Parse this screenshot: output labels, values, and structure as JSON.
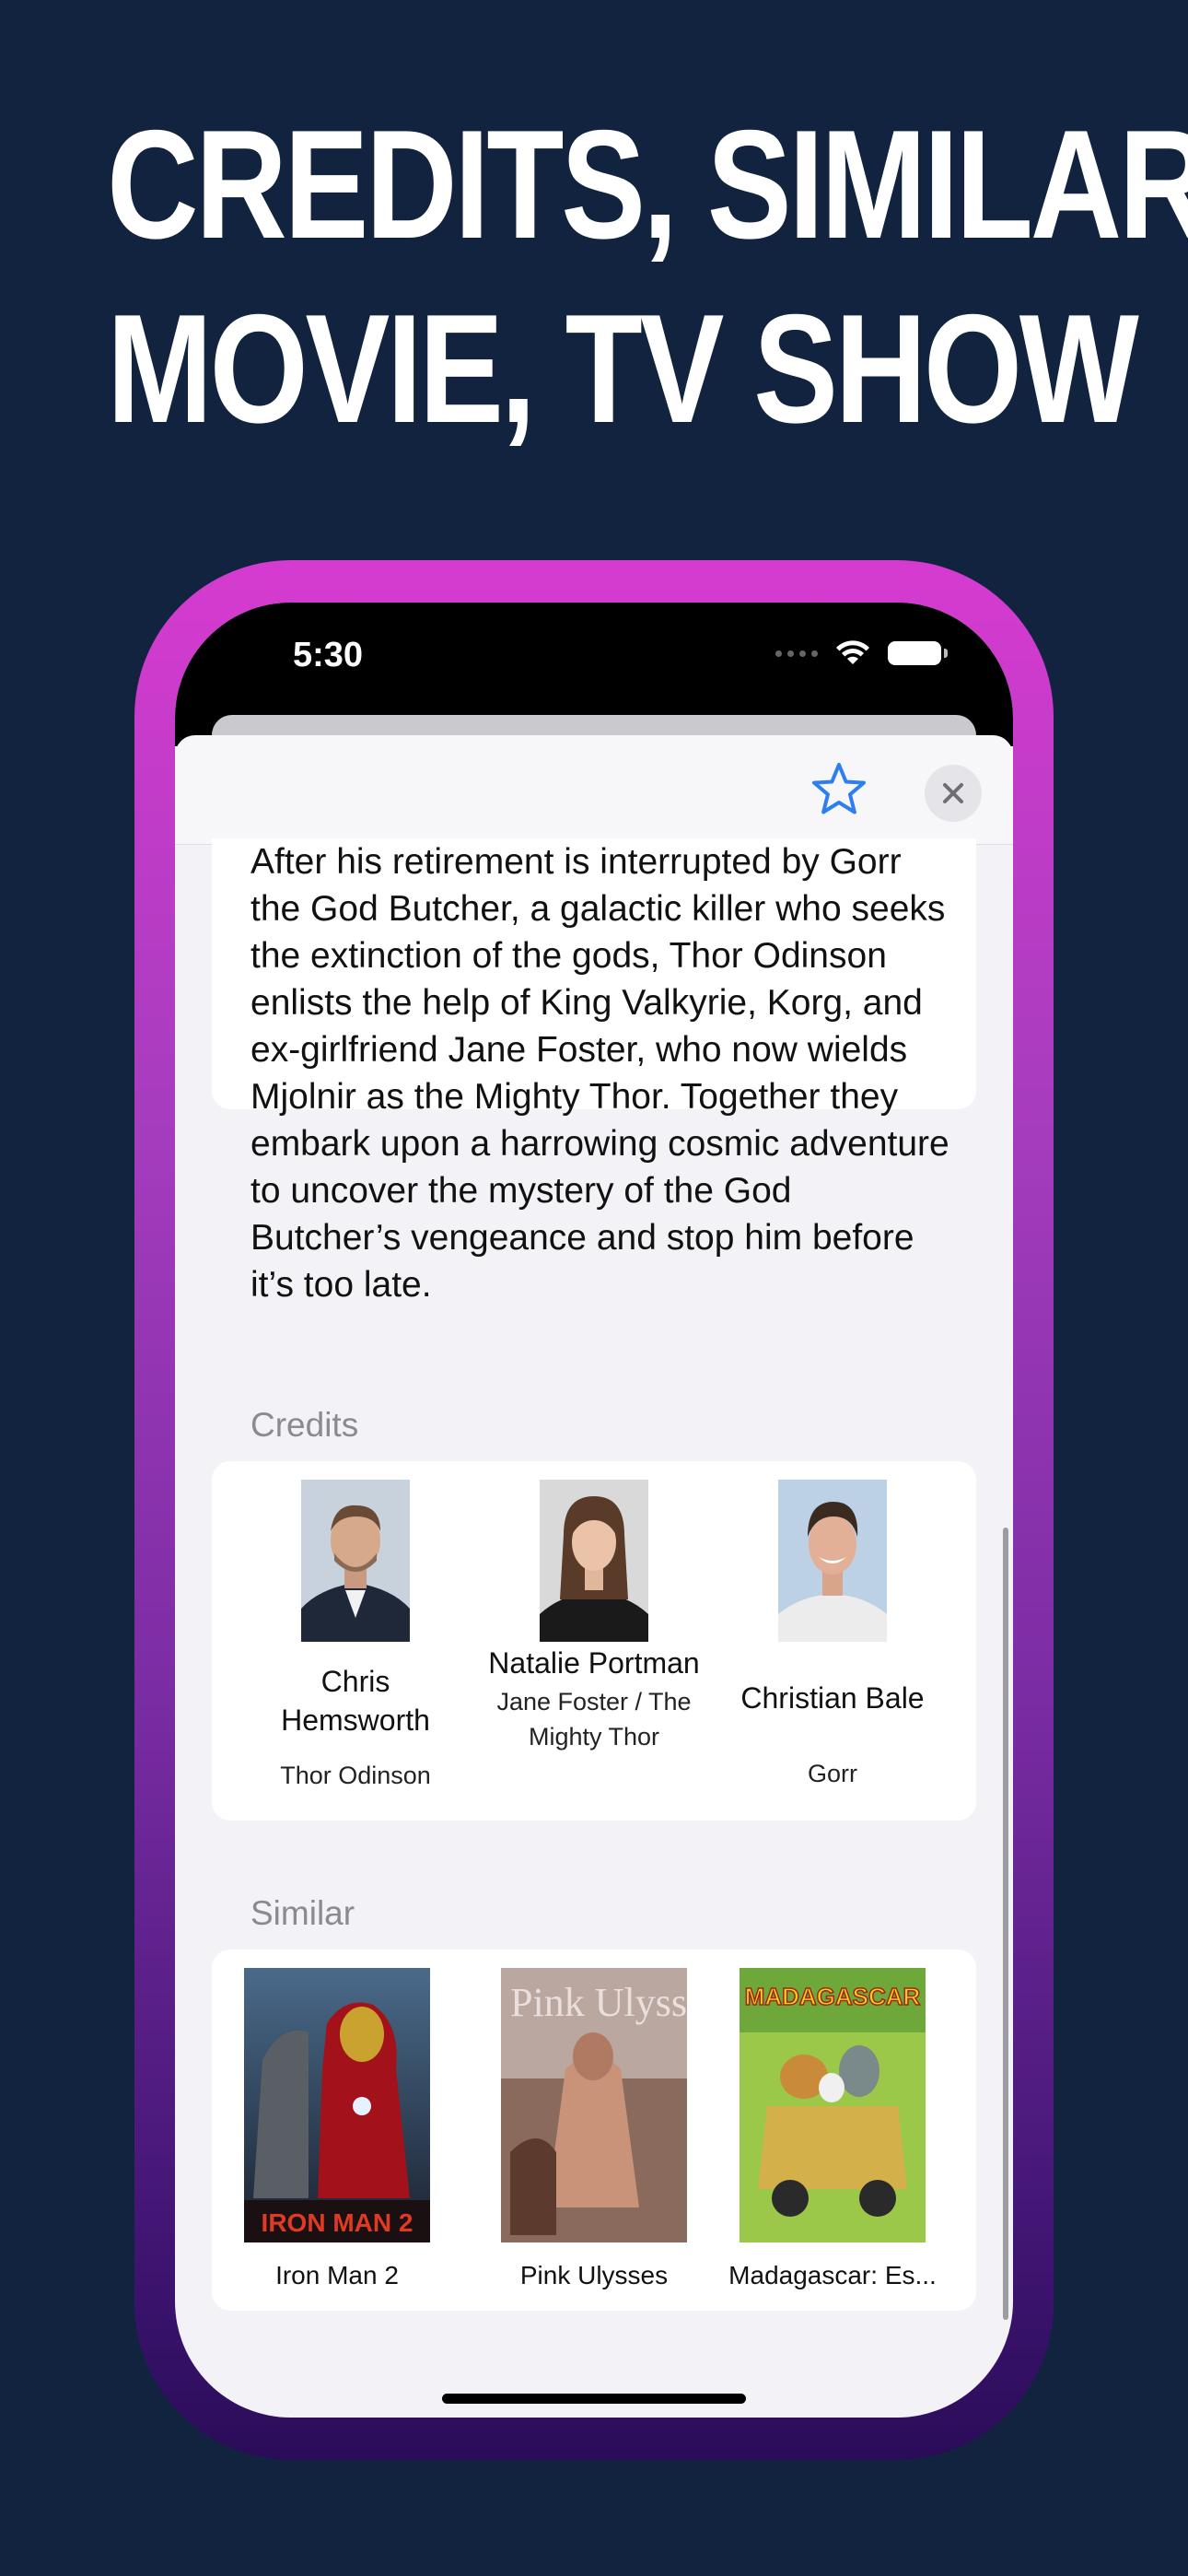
{
  "headline": {
    "line1": "CREDITS, SIMILAR",
    "line2": "MOVIE, TV SHOW"
  },
  "status_bar": {
    "time": "5:30"
  },
  "icons": {
    "favorite": "star-outline-icon",
    "close": "xmark-icon",
    "wifi": "wifi-icon",
    "battery": "battery-icon"
  },
  "colors": {
    "background": "#11233f",
    "accent": "#2f7ef0",
    "frame_top": "#d63bd0",
    "frame_bottom": "#2a0c58"
  },
  "overview": {
    "text": "After his retirement is interrupted by Gorr the God Butcher, a galactic killer who seeks the extinction of the gods, Thor Odinson enlists the help of King Valkyrie, Korg, and ex-girlfriend Jane Foster, who now wields Mjolnir as the Mighty Thor. Together they embark upon a harrowing cosmic adventure to uncover the mystery of the God Butcher’s vengeance and stop him before it’s too late."
  },
  "credits": {
    "label": "Credits",
    "people": [
      {
        "name": "Chris Hemsworth",
        "role": "Thor Odinson"
      },
      {
        "name": "Natalie Portman",
        "role": "Jane Foster / The Mighty Thor"
      },
      {
        "name": "Christian Bale",
        "role": "Gorr"
      }
    ]
  },
  "similar": {
    "label": "Similar",
    "movies": [
      {
        "title": "Iron Man 2",
        "poster_text": "IRON MAN 2"
      },
      {
        "title": "Pink Ulysses",
        "poster_text": "Pink Ulysses"
      },
      {
        "title": "Madagascar: Es...",
        "poster_text": "MADAGASCAR"
      }
    ]
  }
}
